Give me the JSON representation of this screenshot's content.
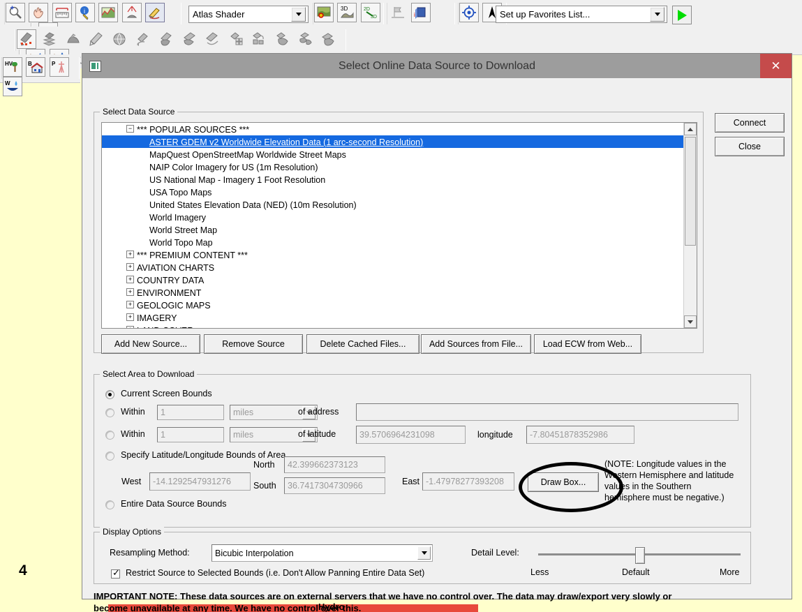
{
  "app": {
    "toolbar_top": {
      "shader_combo_value": "Atlas Shader",
      "favorites_combo_value": "Set up Favorites List...",
      "go_button_label": "",
      "icons": [
        "zoom-in-icon",
        "pan-hand-icon",
        "measure-ruler-icon",
        "feature-info-icon",
        "path-profile-icon",
        "watershed-icon",
        "digitizer-pencil-icon",
        "dropdown-arrow-icon",
        "search-binoculars-icon",
        "map-analysis-icon",
        "3d-view-icon",
        "2d-3d-toggle-icon",
        "flag-marker-icon",
        "3d-cube-icon",
        "sparkle-effect-icon",
        "center-target-icon",
        "north-arrow-icon"
      ]
    },
    "toolbar_digitizer": {
      "icons": [
        "create-point-icon",
        "create-area-icon",
        "create-line-icon",
        "edit-feature-icon",
        "globe-feature-icon",
        "move-feature-icon",
        "copy-area-icon",
        "cut-area-icon",
        "lasso-select-icon",
        "grid-feature-icon",
        "combine-area-icon",
        "merge-area-icon",
        "split-area-icon",
        "simplify-area-icon",
        "draw-line-arrow-icon",
        "draw-line-corner-icon",
        "undo-edit-icon"
      ]
    },
    "toolbar_layers": {
      "icons": [
        "hv-vegetation-icon",
        "b-building-icon",
        "p-power-icon",
        "w-water-icon"
      ]
    },
    "page_number": "4",
    "map_label": "Hydro"
  },
  "dialog": {
    "title": "Select Online Data Source to Download",
    "close_label": "✕",
    "connect_label": "Connect",
    "close_button_label": "Close",
    "data_source": {
      "legend": "Select Data Source",
      "tree": [
        {
          "label": "*** POPULAR SOURCES ***",
          "expander": "−",
          "level": 0,
          "selected": false
        },
        {
          "label": "ASTER GDEM v2 Worldwide Elevation Data (1 arc-second Resolution)",
          "expander": "",
          "level": 1,
          "selected": true
        },
        {
          "label": "MapQuest OpenStreetMap Worldwide Street Maps",
          "expander": "",
          "level": 1,
          "selected": false
        },
        {
          "label": "NAIP Color Imagery for US (1m Resolution)",
          "expander": "",
          "level": 1,
          "selected": false
        },
        {
          "label": "US National Map - Imagery 1 Foot Resolution",
          "expander": "",
          "level": 1,
          "selected": false
        },
        {
          "label": "USA Topo Maps",
          "expander": "",
          "level": 1,
          "selected": false
        },
        {
          "label": "United States Elevation Data (NED) (10m Resolution)",
          "expander": "",
          "level": 1,
          "selected": false
        },
        {
          "label": "World Imagery",
          "expander": "",
          "level": 1,
          "selected": false
        },
        {
          "label": "World Street Map",
          "expander": "",
          "level": 1,
          "selected": false
        },
        {
          "label": "World Topo Map",
          "expander": "",
          "level": 1,
          "selected": false
        },
        {
          "label": "*** PREMIUM CONTENT ***",
          "expander": "+",
          "level": 0,
          "selected": false
        },
        {
          "label": "AVIATION CHARTS",
          "expander": "+",
          "level": 0,
          "selected": false
        },
        {
          "label": "COUNTRY DATA",
          "expander": "+",
          "level": 0,
          "selected": false
        },
        {
          "label": "ENVIRONMENT",
          "expander": "+",
          "level": 0,
          "selected": false
        },
        {
          "label": "GEOLOGIC MAPS",
          "expander": "+",
          "level": 0,
          "selected": false
        },
        {
          "label": "IMAGERY",
          "expander": "+",
          "level": 0,
          "selected": false
        },
        {
          "label": "LAND COVER",
          "expander": "+",
          "level": 0,
          "selected": false
        }
      ],
      "buttons": [
        "Add New Source...",
        "Remove Source",
        "Delete Cached Files...",
        "Add Sources from File...",
        "Load ECW from Web..."
      ]
    },
    "select_area": {
      "legend": "Select Area to Download",
      "opt_current_screen": "Current Screen Bounds",
      "opt_within_address": "Within",
      "opt_within_address_value": "1",
      "opt_within_address_units": "miles",
      "of_address_label": "of address",
      "address_value": "",
      "opt_within_latlon": "Within",
      "opt_within_latlon_value": "1",
      "opt_within_latlon_units": "miles",
      "of_latitude_label": "of latitude",
      "latitude_value": "39.5706964231098",
      "longitude_label": "longitude",
      "longitude_value": "-7.80451878352986",
      "opt_specify_bounds": "Specify Latitude/Longitude Bounds of Area",
      "west_label": "West",
      "west_value": "-14.1292547931276",
      "north_label": "North",
      "north_value": "42.399662373123",
      "south_label": "South",
      "south_value": "36.7417304730966",
      "east_label": "East",
      "east_value": "-1.47978277393208",
      "draw_box_label": "Draw Box...",
      "note_line1": "(NOTE: Longitude values in the",
      "note_line2": "Western Hemisphere and latitude",
      "note_line3": "values in the Southern",
      "note_line4": "hemisphere must be negative.)",
      "opt_entire_bounds": "Entire Data Source Bounds",
      "selected_option": "current_screen"
    },
    "display_options": {
      "legend": "Display Options",
      "resampling_label": "Resampling Method:",
      "resampling_value": "Bicubic Interpolation",
      "restrict_label": "Restrict Source to Selected Bounds (i.e. Don't Allow Panning Entire Data Set)",
      "restrict_checked": true,
      "detail_label": "Detail Level:",
      "detail_less": "Less",
      "detail_default": "Default",
      "detail_more": "More",
      "detail_value": 50
    },
    "important_note": {
      "line1": "IMPORTANT NOTE: These data sources are on external servers that we have no control over. The data may draw/export very slowly or",
      "line2": "become unavailable at any time. We have no control over this."
    }
  },
  "colors": {
    "selection_blue": "#1569e0",
    "title_bar": "#9d9d9d",
    "close_red": "#c54b4b",
    "canvas_yellow": "#ffffcc",
    "dialog_face": "#f0f0f0",
    "annotation_black": "#000000",
    "map_red": "#e8493b",
    "go_green": "#00dd00"
  }
}
